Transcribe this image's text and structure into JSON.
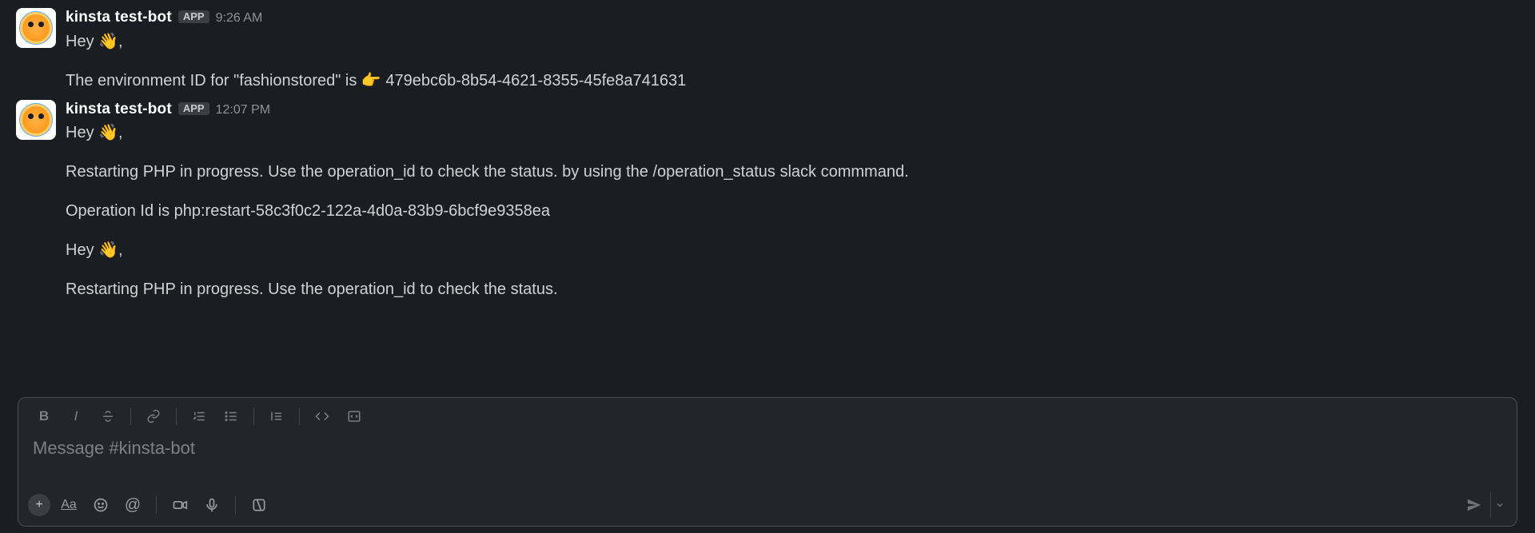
{
  "messages": [
    {
      "author": "kinsta test-bot",
      "badge": "APP",
      "timestamp": "9:26 AM",
      "lines": [
        {
          "prefix": "Hey ",
          "emoji": "👋",
          "suffix": ","
        },
        {
          "prefix": "The environment ID for \"fashionstored\" is ",
          "emoji": "👉",
          "suffix": " 479ebc6b-8b54-4621-8355-45fe8a741631",
          "spaced": true
        }
      ]
    },
    {
      "author": "kinsta test-bot",
      "badge": "APP",
      "timestamp": "12:07 PM",
      "lines": [
        {
          "prefix": "Hey ",
          "emoji": "👋",
          "suffix": ","
        },
        {
          "text": "Restarting PHP in progress. Use the operation_id to check the status. by using the /operation_status slack commmand.",
          "spaced": true
        },
        {
          "text": "Operation Id is php:restart-58c3f0c2-122a-4d0a-83b9-6bcf9e9358ea",
          "spaced": true
        },
        {
          "prefix": "Hey ",
          "emoji": "👋",
          "suffix": ",",
          "spaced": true
        },
        {
          "text": "Restarting PHP in progress. Use the operation_id to check the status.",
          "spaced": true
        }
      ]
    }
  ],
  "composer": {
    "placeholder": "Message #kinsta-bot"
  },
  "labels": {
    "bold": "B",
    "italic": "I",
    "aa": "Aa",
    "mention": "@",
    "plus": "+"
  }
}
